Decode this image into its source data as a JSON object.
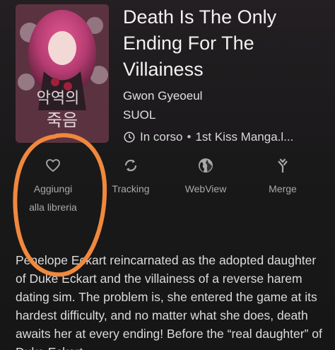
{
  "manga": {
    "title": "Death Is The Only Ending For The Villainess",
    "author": "Gwon Gyeoeul",
    "artist": "SUOL",
    "status": "In corso",
    "separator": "•",
    "source": "1st Kiss Manga.l..."
  },
  "actions": {
    "library_label": "Aggiungi alla libreria",
    "tracking_label": "Tracking",
    "webview_label": "WebView",
    "merge_label": "Merge"
  },
  "description": "Penelope Eckart reincarnated as the adopted daughter of Duke Eckart and the villainess of a reverse harem dating sim. The problem is, she entered the game at its hardest difficulty, and no matter what she does, death awaits her at every ending! Before the “real daughter” of Duke Eckart",
  "colors": {
    "background": "#1a1a1a",
    "annotation": "#f0883e",
    "icon": "#a9a9a9"
  },
  "icons": {
    "library": "heart-outline-icon",
    "tracking": "sync-icon",
    "webview": "globe-icon",
    "merge": "merge-icon",
    "status": "clock-icon"
  }
}
